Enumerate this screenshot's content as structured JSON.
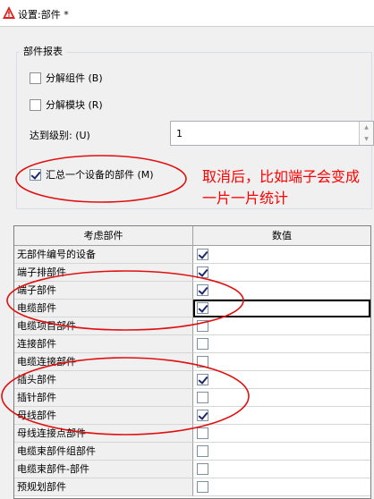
{
  "window": {
    "title": "设置:部件 *",
    "icon": "warning-triangle-icon",
    "accent_color": "#e0201b"
  },
  "parts_report": {
    "legend": "部件报表",
    "decompose_components": {
      "label": "分解组件 (B)",
      "checked": false
    },
    "decompose_modules": {
      "label": "分解模块 (R)",
      "checked": false
    },
    "level": {
      "label": "达到级别: (U)",
      "value": "1"
    },
    "summarize_device_parts": {
      "label": "汇总一个设备的部件 (M)",
      "checked": true
    }
  },
  "annotation": {
    "text": "取消后，比如端子会变成一片一片统计",
    "color": "#ff0000"
  },
  "grid": {
    "columns": [
      "考虑部件",
      "数值"
    ],
    "rows": [
      {
        "label": "无部件编号的设备",
        "checked": true
      },
      {
        "label": "端子排部件",
        "checked": true
      },
      {
        "label": "端子部件",
        "checked": true
      },
      {
        "label": "电缆部件",
        "checked": true
      },
      {
        "label": "电缆项目部件",
        "checked": false
      },
      {
        "label": "连接部件",
        "checked": false
      },
      {
        "label": "电缆连接部件",
        "checked": false
      },
      {
        "label": "插头部件",
        "checked": true
      },
      {
        "label": "插针部件",
        "checked": false
      },
      {
        "label": "母线部件",
        "checked": true
      },
      {
        "label": "母线连接点部件",
        "checked": false
      },
      {
        "label": "电缆束部件组部件",
        "checked": false
      },
      {
        "label": "电缆束部件-部件",
        "checked": false
      },
      {
        "label": "预规划部件",
        "checked": false
      }
    ]
  }
}
